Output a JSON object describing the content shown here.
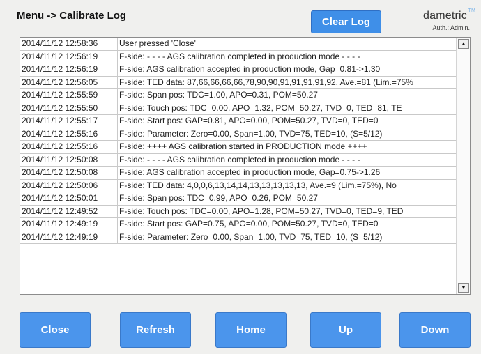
{
  "header": {
    "title": "Menu -> Calibrate Log",
    "clear_label": "Clear Log",
    "brand": "dametric",
    "brand_tm": "TM",
    "auth": "Auth.: Admin."
  },
  "log": [
    {
      "time": "2014/11/12 12:58:36",
      "message": "User pressed 'Close'"
    },
    {
      "time": "2014/11/12 12:56:19",
      "message": "F-side: - - - - AGS calibration completed in production mode - - - -"
    },
    {
      "time": "2014/11/12 12:56:19",
      "message": "F-side: AGS calibration accepted in production mode, Gap=0.81->1.30"
    },
    {
      "time": "2014/11/12 12:56:05",
      "message": "F-side: TED  data: 87,66,66,66,66,78,90,90,91,91,91,91,92, Ave.=81 (Lim.=75%"
    },
    {
      "time": "2014/11/12 12:55:59",
      "message": "F-side: Span pos: TDC=1.00, APO=0.31, POM=50.27"
    },
    {
      "time": "2014/11/12 12:55:50",
      "message": "F-side: Touch pos: TDC=0.00, APO=1.32, POM=50.27, TVD=0, TED=81, TE"
    },
    {
      "time": "2014/11/12 12:55:17",
      "message": "F-side: Start pos: GAP=0.81, APO=0.00, POM=50.27, TVD=0, TED=0"
    },
    {
      "time": "2014/11/12 12:55:16",
      "message": "F-side: Parameter: Zero=0.00, Span=1.00, TVD=75, TED=10, (S=5/12)"
    },
    {
      "time": "2014/11/12 12:55:16",
      "message": "F-side: ++++ AGS calibration started in PRODUCTION mode ++++"
    },
    {
      "time": "2014/11/12 12:50:08",
      "message": "F-side: - - - - AGS calibration completed in production mode - - - -"
    },
    {
      "time": "2014/11/12 12:50:08",
      "message": "F-side: AGS calibration accepted in production mode, Gap=0.75->1.26"
    },
    {
      "time": "2014/11/12 12:50:06",
      "message": "F-side: TED  data: 4,0,0,6,13,14,14,13,13,13,13,13, Ave.=9 (Lim.=75%), No"
    },
    {
      "time": "2014/11/12 12:50:01",
      "message": "F-side: Span  pos: TDC=0.99, APO=0.26, POM=50.27"
    },
    {
      "time": "2014/11/12 12:49:52",
      "message": "F-side: Touch pos: TDC=0.00, APO=1.28, POM=50.27, TVD=0, TED=9, TED"
    },
    {
      "time": "2014/11/12 12:49:19",
      "message": "F-side: Start pos: GAP=0.75, APO=0.00, POM=50.27, TVD=0, TED=0"
    },
    {
      "time": "2014/11/12 12:49:19",
      "message": "F-side: Parameter: Zero=0.00, Span=1.00, TVD=75, TED=10, (S=5/12)"
    }
  ],
  "scrollbar": {
    "up_icon": "triangle-up",
    "down_icon": "triangle-down"
  },
  "buttons": {
    "close": "Close",
    "refresh": "Refresh",
    "home": "Home",
    "up": "Up",
    "down": "Down"
  },
  "colors": {
    "button_blue": "#4b95ec",
    "background": "#f0f0ee"
  }
}
